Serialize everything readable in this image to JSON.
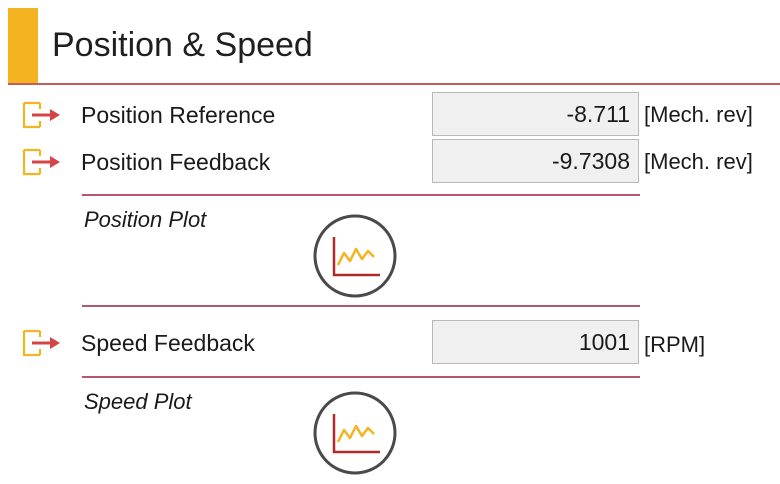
{
  "header": {
    "title": "Position & Speed"
  },
  "rows": [
    {
      "label": "Position Reference",
      "value": "-8.711",
      "unit": "[Mech. rev]",
      "icon": "input-arrow-icon"
    },
    {
      "label": "Position Feedback",
      "value": "-9.7308",
      "unit": "[Mech. rev]",
      "icon": "input-arrow-icon"
    },
    {
      "label": "Speed Feedback",
      "value": "1001",
      "unit": "[RPM]",
      "icon": "input-arrow-icon"
    }
  ],
  "plots": [
    {
      "label": "Position Plot",
      "icon": "line-chart-icon"
    },
    {
      "label": "Speed Plot",
      "icon": "line-chart-icon"
    }
  ],
  "colors": {
    "accent": "#f4b321",
    "arrow": "#d64545",
    "divider": "#b5576a",
    "chart_line": "#f4b321",
    "chart_axes": "#b02a2a",
    "plot_ring": "#4a4a4a"
  }
}
